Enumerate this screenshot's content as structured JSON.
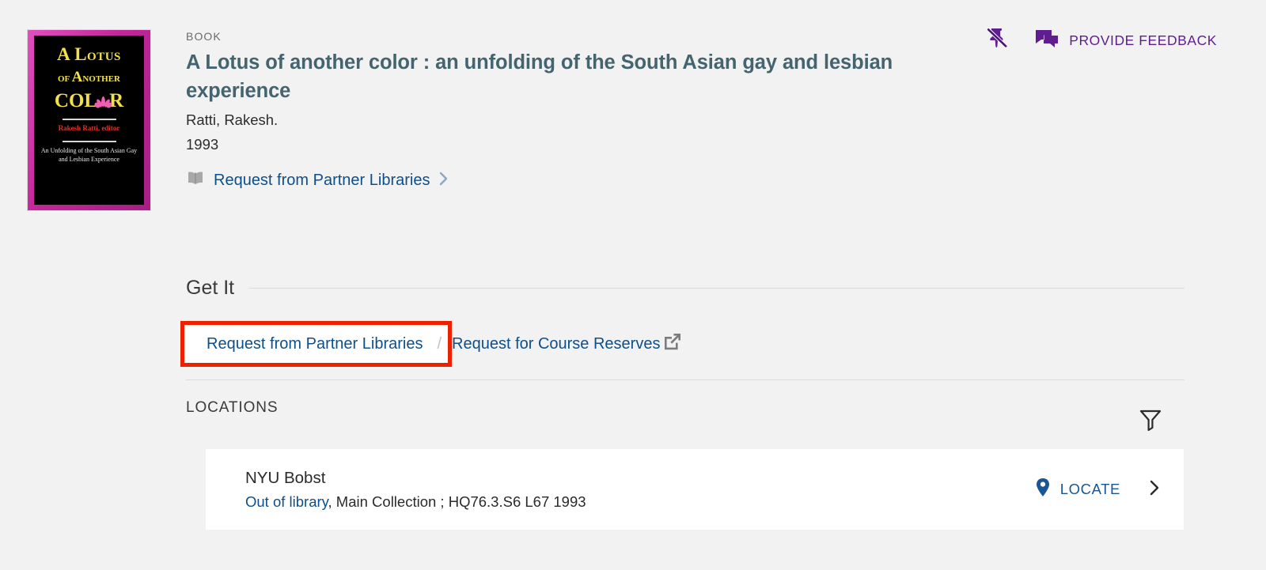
{
  "record": {
    "type_label": "BOOK",
    "title": "A Lotus of another color : an unfolding of the South Asian gay and lesbian experience",
    "author": "Ratti, Rakesh.",
    "year": "1993",
    "action_link": "Request from Partner Libraries",
    "book_icon": "book-icon",
    "chevron_icon": "chevron-right-icon",
    "cover": {
      "line1_a": "A ",
      "line1_b": "L",
      "line1_c": "OTUS",
      "line2_a": "OF ",
      "line2_b": "A",
      "line2_c": "NOTHER",
      "line3_a": "C",
      "line3_b": "OL",
      "line3_c": "R",
      "editor": "Rakesh Ratti, editor",
      "subtitle": "An Unfolding of the South Asian Gay and Lesbian Experience"
    }
  },
  "top_actions": {
    "pin_icon": "pin-off-icon",
    "feedback_icon": "chat-bubbles-icon",
    "feedback_label": "PROVIDE FEEDBACK"
  },
  "get_it": {
    "heading": "Get It",
    "link_partner": "Request from Partner Libraries",
    "separator": "/",
    "link_reserves": "Request for Course Reserves",
    "external_icon": "external-link-icon",
    "highlight_color": "#ed2000"
  },
  "locations": {
    "heading": "LOCATIONS",
    "filter_icon": "filter-funnel-icon",
    "items": [
      {
        "library": "NYU Bobst",
        "status": "Out of library",
        "details": ", Main Collection ; HQ76.3.S6 L67 1993",
        "locate_label": "LOCATE",
        "locate_icon": "map-pin-icon",
        "chevron_icon": "chevron-right-icon"
      }
    ]
  },
  "colors": {
    "page_bg": "#f2f2f2",
    "link_blue": "#0d4f8b",
    "title_teal": "#44646f",
    "purple": "#5f1d90",
    "red_highlight": "#ed2000"
  }
}
